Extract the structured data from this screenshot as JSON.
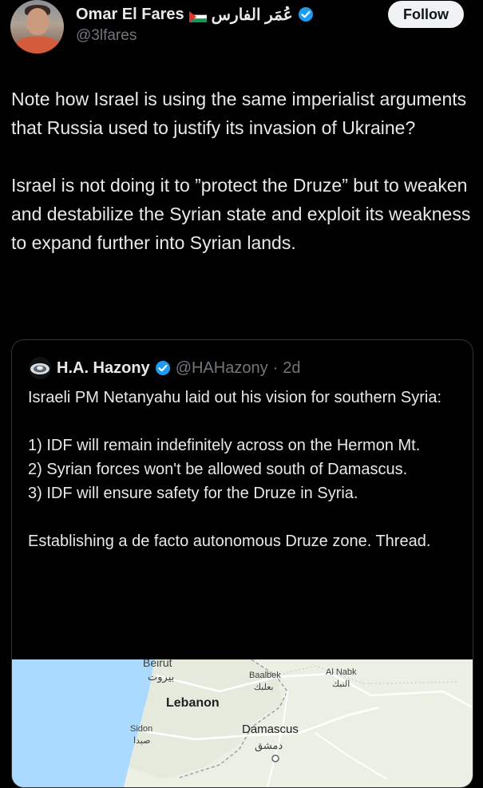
{
  "author": {
    "name": "Omar El Fares",
    "arabic_name": "عُمَر الفارس",
    "handle": "@3lfares",
    "flag_icon": "palestine-flag-icon",
    "verified_icon": "verified-badge-icon"
  },
  "follow_button": {
    "label": "Follow"
  },
  "tweet": {
    "paragraphs": [
      "Note how Israel is using the same imperialist arguments that Russia used to justify its invasion of Ukraine?",
      "Israel is not doing it to ”protect the Druze” but to weaken and destabilize the Syrian state and exploit its weakness to expand further into Syrian lands."
    ]
  },
  "quoted_tweet": {
    "name": "H.A. Hazony",
    "handle": "@HAHazony",
    "separator": "·",
    "time": "2d",
    "paragraphs": [
      "Israeli PM Netanyahu laid out his vision for southern Syria:",
      "1) IDF will remain indefinitely across on the Hermon Mt.\n2) Syrian forces won't be allowed south of Damascus.\n3) IDF will ensure safety for the Druze in Syria.",
      "Establishing a de facto autonomous Druze zone. Thread."
    ],
    "map": {
      "labels": {
        "beirut": "Beirut",
        "beirut_ar": "بيروت",
        "lebanon": "Lebanon",
        "sidon": "Sidon",
        "sidon_ar": "صيدا",
        "baalbek": "Baalbek",
        "baalbek_ar": "بعلبك",
        "al_nabk": "Al Nabk",
        "al_nabk_ar": "النبك",
        "damascus": "Damascus",
        "damascus_ar": "دمشق"
      },
      "colors": {
        "land": "#ecefe4",
        "sea": "#aadaff",
        "border": "#9aa0a6",
        "road": "#ffffff"
      }
    }
  },
  "colors": {
    "background": "#000000",
    "text": "#e7e9ea",
    "muted": "#71767b",
    "verified": "#1d9bf0",
    "quote_border": "#2f3336"
  }
}
